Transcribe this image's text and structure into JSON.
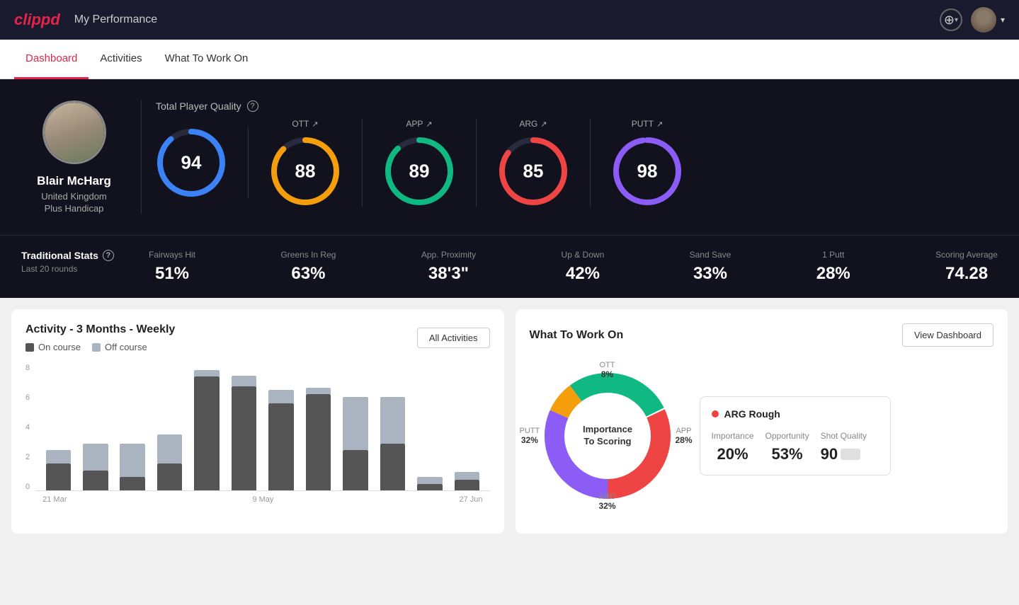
{
  "app": {
    "logo": "clippd",
    "header_title": "My Performance"
  },
  "nav": {
    "tabs": [
      {
        "label": "Dashboard",
        "active": true
      },
      {
        "label": "Activities",
        "active": false
      },
      {
        "label": "What To Work On",
        "active": false
      }
    ]
  },
  "player": {
    "name": "Blair McHarg",
    "country": "United Kingdom",
    "handicap": "Plus Handicap"
  },
  "quality": {
    "label": "Total Player Quality",
    "total": {
      "value": "94",
      "color": "#3b82f6"
    },
    "ott": {
      "label": "OTT",
      "value": "88",
      "color": "#f59e0b"
    },
    "app": {
      "label": "APP",
      "value": "89",
      "color": "#10b981"
    },
    "arg": {
      "label": "ARG",
      "value": "85",
      "color": "#ef4444"
    },
    "putt": {
      "label": "PUTT",
      "value": "98",
      "color": "#8b5cf6"
    }
  },
  "traditional_stats": {
    "label": "Traditional Stats",
    "sublabel": "Last 20 rounds",
    "items": [
      {
        "name": "Fairways Hit",
        "value": "51%"
      },
      {
        "name": "Greens In Reg",
        "value": "63%"
      },
      {
        "name": "App. Proximity",
        "value": "38'3\""
      },
      {
        "name": "Up & Down",
        "value": "42%"
      },
      {
        "name": "Sand Save",
        "value": "33%"
      },
      {
        "name": "1 Putt",
        "value": "28%"
      },
      {
        "name": "Scoring Average",
        "value": "74.28"
      }
    ]
  },
  "activity_chart": {
    "title": "Activity - 3 Months - Weekly",
    "legend": {
      "on_course": "On course",
      "off_course": "Off course"
    },
    "all_activities_label": "All Activities",
    "x_labels": [
      "21 Mar",
      "9 May",
      "27 Jun"
    ],
    "y_labels": [
      "8",
      "6",
      "4",
      "2",
      "0"
    ],
    "bars": [
      {
        "on": 20,
        "off": 10
      },
      {
        "on": 15,
        "off": 20
      },
      {
        "on": 10,
        "off": 25
      },
      {
        "on": 20,
        "off": 22
      },
      {
        "on": 85,
        "off": 5
      },
      {
        "on": 78,
        "off": 8
      },
      {
        "on": 65,
        "off": 10
      },
      {
        "on": 72,
        "off": 5
      },
      {
        "on": 30,
        "off": 40
      },
      {
        "on": 35,
        "off": 35
      },
      {
        "on": 5,
        "off": 5
      },
      {
        "on": 8,
        "off": 6
      }
    ]
  },
  "work_on": {
    "title": "What To Work On",
    "view_dashboard_label": "View Dashboard",
    "center_text": "Importance\nTo Scoring",
    "segments": [
      {
        "label": "OTT",
        "value": "8%",
        "color": "#f59e0b",
        "angle": 8
      },
      {
        "label": "APP",
        "value": "28%",
        "color": "#10b981",
        "angle": 28
      },
      {
        "label": "ARG",
        "value": "32%",
        "color": "#ef4444",
        "angle": 32
      },
      {
        "label": "PUTT",
        "value": "32%",
        "color": "#8b5cf6",
        "angle": 32
      }
    ],
    "info_card": {
      "title": "ARG Rough",
      "dot_color": "#ef4444",
      "metrics": [
        {
          "label": "Importance",
          "value": "20%"
        },
        {
          "label": "Opportunity",
          "value": "53%"
        },
        {
          "label": "Shot Quality",
          "value": "90"
        }
      ]
    }
  }
}
